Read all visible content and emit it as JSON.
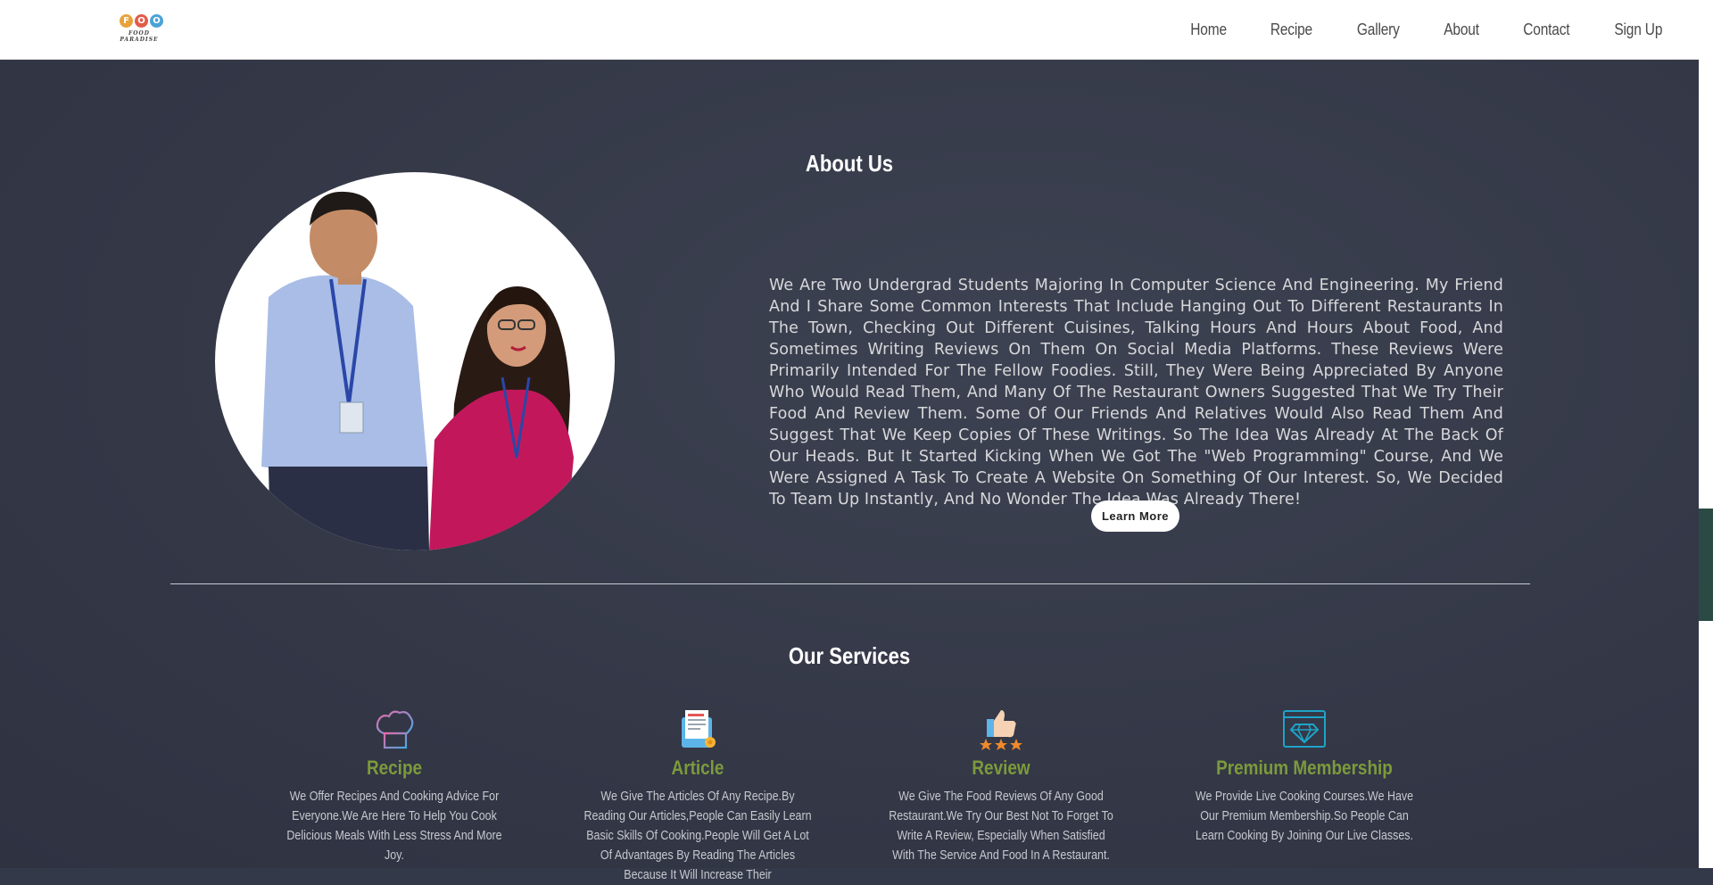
{
  "brand": {
    "logo_letters": [
      "F",
      "O",
      "O"
    ],
    "logo_colors": [
      "#e8a23a",
      "#e35b4b",
      "#4aa3d8"
    ],
    "tagline": "FOOD PARADISE"
  },
  "nav": {
    "items": [
      "Home",
      "Recipe",
      "Gallery",
      "About",
      "Contact",
      "Sign Up"
    ]
  },
  "about": {
    "title": "About Us",
    "text": "We Are Two Undergrad Students Majoring In Computer Science And Engineering. My Friend And I Share Some Common Interests That Include Hanging Out To Different Restaurants In The Town, Checking Out Different Cuisines, Talking Hours And Hours About Food, And Sometimes Writing Reviews On Them On Social Media Platforms. These Reviews Were Primarily Intended For The Fellow Foodies. Still, They Were Being Appreciated By Anyone Who Would Read Them, And Many Of The Restaurant Owners Suggested That We Try Their Food And Review Them. Some Of Our Friends And Relatives Would Also Read Them And Suggest That We Keep Copies Of These Writings. So The Idea Was Already At The Back Of Our Heads. But It Started Kicking When We Got The \"Web Programming\" Course, And We Were Assigned A Task To Create A Website On Something Of Our Interest. So, We Decided To Team Up Instantly, And No Wonder The Idea Was Already There!",
    "button": "Learn More"
  },
  "services": {
    "title": "Our Services",
    "items": [
      {
        "icon": "chef-hat-icon",
        "name": "Recipe",
        "desc": "We Offer Recipes And Cooking Advice For Everyone.We Are Here To Help You Cook Delicious Meals With Less Stress And More Joy."
      },
      {
        "icon": "article-certificate-icon",
        "name": "Article",
        "desc": "We Give The Articles Of Any Recipe.By Reading Our Articles,People Can Easily Learn Basic Skills Of Cooking.People Will Get A Lot Of Advantages By Reading The Articles Because It Will Increase Their"
      },
      {
        "icon": "thumbs-up-stars-icon",
        "name": "Review",
        "desc": "We Give The Food Reviews Of Any Good Restaurant.We Try Our Best Not To Forget To Write A Review, Especially When Satisfied With The Service And Food In A Restaurant."
      },
      {
        "icon": "diamond-window-icon",
        "name": "Premium Membership",
        "desc": "We Provide Live Cooking Courses.We Have Our Premium Membership.So People Can Learn Cooking By Joining Our Live Classes."
      }
    ]
  },
  "colors": {
    "accent": "#7c9a3c",
    "background": "#34394a"
  }
}
